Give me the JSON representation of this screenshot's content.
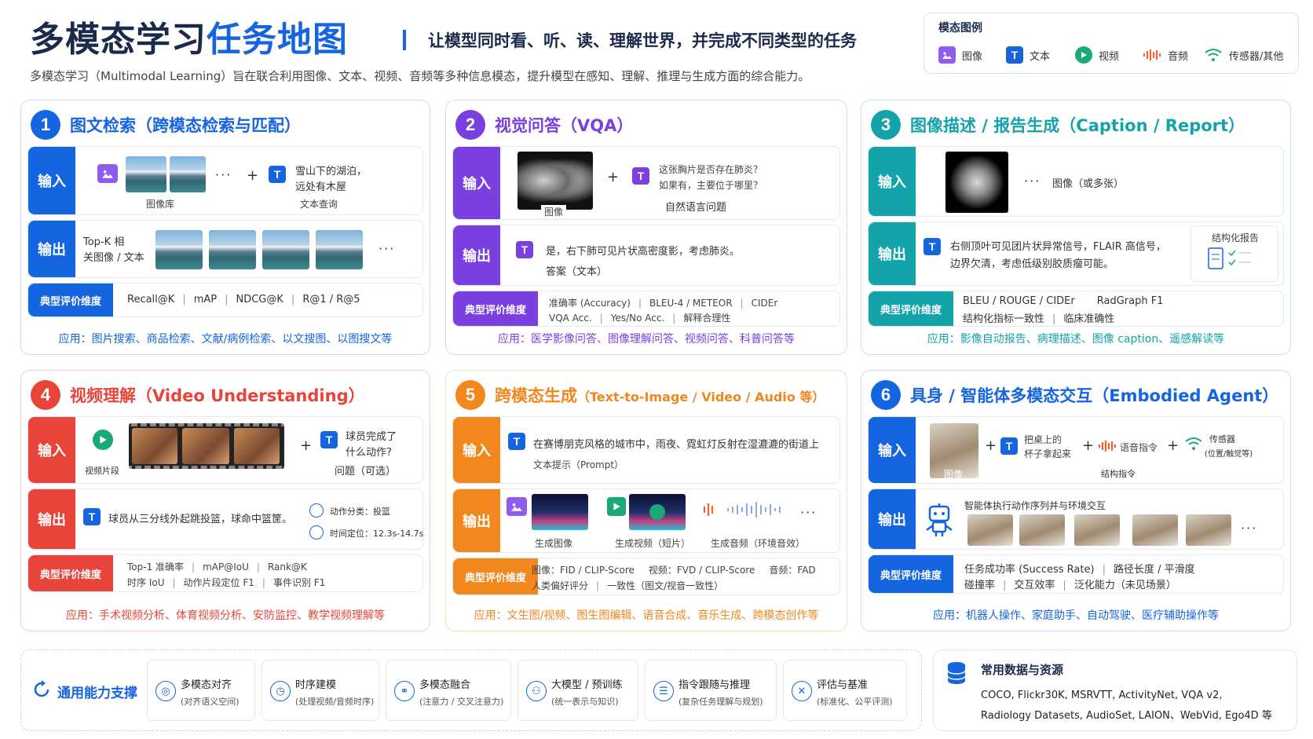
{
  "header": {
    "title_part1": "多模态学习",
    "title_part2": "任务地图",
    "tagline": "让模型同时看、听、读、理解世界，并完成不同类型的任务",
    "description": "多模态学习（Multimodal Learning）旨在联合利用图像、文本、视频、音频等多种信息模态，提升模型在感知、理解、推理与生成方面的综合能力。"
  },
  "legend": {
    "title": "模态图例",
    "items": [
      {
        "label": "图像",
        "icon": "image-icon"
      },
      {
        "label": "文本",
        "icon": "text-icon",
        "glyph": "T"
      },
      {
        "label": "视频",
        "icon": "video-icon"
      },
      {
        "label": "音频",
        "icon": "audio-icon"
      },
      {
        "label": "传感器/其他",
        "icon": "sensor-icon"
      }
    ]
  },
  "labels": {
    "input": "输入",
    "output": "输出",
    "eval": "典型评价维度",
    "text_glyph": "T"
  },
  "colors": {
    "blue": "#1565e0",
    "purple": "#7a3fe0",
    "teal": "#13a3a8",
    "red": "#e8443a",
    "orange": "#f2871d",
    "navy": "#1a2a4a"
  },
  "cards": {
    "c1": {
      "number": "1",
      "title": "图文检索（跨模态检索与匹配）",
      "input_images_caption": "图像库",
      "input_text": [
        "雪山下的湖泊，",
        "远处有木屋"
      ],
      "input_text_caption": "文本查询",
      "output_text": [
        "Top-K 相",
        "关图像 / 文本"
      ],
      "eval": [
        "Recall@K",
        "mAP",
        "NDCG@K",
        "R@1 / R@5"
      ],
      "application": "应用：图片搜索、商品检索、文献/病例检索、以文搜图、以图搜文等"
    },
    "c2": {
      "number": "2",
      "title": "视觉问答（VQA）",
      "input_image_caption": "图像",
      "input_text": [
        "这张胸片是否存在肺炎？",
        "如果有，主要位于哪里？"
      ],
      "input_text_caption": "自然语言问题",
      "output_text": "是，右下肺可见片状高密度影，考虑肺炎。",
      "output_caption": "答案（文本）",
      "eval_line1": [
        "准确率 (Accuracy)",
        "BLEU-4 / METEOR",
        "CIDEr"
      ],
      "eval_line2": [
        "VQA Acc.",
        "Yes/No Acc.",
        "解释合理性"
      ],
      "application": "应用：医学影像问答、图像理解问答、视频问答、科普问答等"
    },
    "c3": {
      "number": "3",
      "title": "图像描述 / 报告生成（Caption / Report）",
      "input_caption": "图像（或多张）",
      "output_text": [
        "右侧顶叶可见团片状异常信号，FLAIR 高信号，",
        "边界欠清，考虑低级别胶质瘤可能。"
      ],
      "report_label": "结构化报告",
      "eval_line1": [
        "BLEU / ROUGE / CIDEr",
        "RadGraph F1"
      ],
      "eval_line2": [
        "结构化指标一致性",
        "临床准确性"
      ],
      "application": "应用：影像自动报告、病理描述、图像 caption、遥感解读等"
    },
    "c4": {
      "number": "4",
      "title": "视频理解（Video Understanding）",
      "input_video_caption": "视频片段",
      "input_text": [
        "球员完成了",
        "什么动作?"
      ],
      "input_text_caption": "问题（可选）",
      "output_text": "球员从三分线外起跳投篮，球命中篮筐。",
      "output_action": "动作分类：投篮",
      "output_time": "时间定位：12.3s-14.7s",
      "eval_line1": [
        "Top-1 准确率",
        "mAP@IoU",
        "Rank@K"
      ],
      "eval_line2": [
        "时序 IoU",
        "动作片段定位 F1",
        "事件识别 F1"
      ],
      "application": "应用：手术视频分析、体育视频分析、安防监控、教学视频理解等"
    },
    "c5": {
      "number": "5",
      "title_main": "跨模态生成",
      "title_sub": "（Text-to-Image / Video / Audio 等）",
      "input_text": "在赛博朋克风格的城市中，雨夜、霓虹灯反射在湿漉漉的街道上",
      "input_caption": "文本提示（Prompt）",
      "out_image_caption": "生成图像",
      "out_video_caption": "生成视频（短片）",
      "out_audio_caption": "生成音频（环境音效）",
      "eval_line1": [
        "图像：FID / CLIP-Score",
        "视频：FVD / CLIP-Score",
        "音频：FAD"
      ],
      "eval_line2": [
        "人类偏好评分",
        "一致性（图文/视音一致性）"
      ],
      "application": "应用：文生图/视频、图生图编辑、语音合成、音乐生成、跨模态创作等"
    },
    "c6": {
      "number": "6",
      "title": "具身 / 智能体多模态交互（Embodied Agent）",
      "input_image_caption": "图像",
      "input_text": [
        "把桌上的",
        "杯子拿起来"
      ],
      "input_audio": "语音指令",
      "input_sensor": [
        "传感器",
        "(位置/触觉等)"
      ],
      "input_caption": "结构指令",
      "output_title": "智能体执行动作序列并与环境交互",
      "eval_line1": [
        "任务成功率 (Success Rate)",
        "路径长度 / 平滑度"
      ],
      "eval_line2": [
        "碰撞率",
        "交互效率",
        "泛化能力（未见场景）"
      ],
      "application": "应用：机器人操作、家庭助手、自动驾驶、医疗辅助操作等"
    }
  },
  "support": {
    "title": "通用能力支撑",
    "items": [
      {
        "title": "多模态对齐",
        "sub": "(对齐语义空间)",
        "icon": "align-icon"
      },
      {
        "title": "时序建模",
        "sub": "(处理视频/音频时序)",
        "icon": "timeline-icon"
      },
      {
        "title": "多模态融合",
        "sub": "(注意力 / 交叉注意力)",
        "icon": "fusion-icon"
      },
      {
        "title": "大模型 / 预训练",
        "sub": "(统一表示与知识)",
        "icon": "model-icon"
      },
      {
        "title": "指令跟随与推理",
        "sub": "(复杂任务理解与规划)",
        "icon": "reasoning-icon"
      },
      {
        "title": "评估与基准",
        "sub": "(标准化、公平评测)",
        "icon": "benchmark-icon"
      }
    ]
  },
  "resources": {
    "title": "常用数据与资源",
    "line1": "COCO, Flickr30K, MSRVTT, ActivityNet, VQA v2,",
    "line2": "Radiology Datasets, AudioSet, LAION、WebVid, Ego4D 等"
  }
}
